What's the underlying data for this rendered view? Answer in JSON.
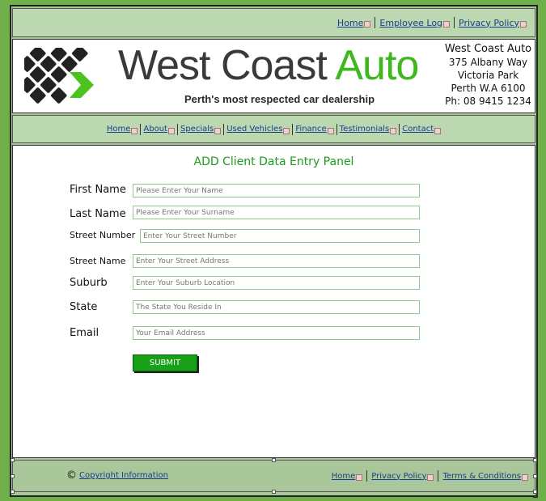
{
  "top_nav": {
    "items": [
      {
        "label": "Home"
      },
      {
        "label": "Employee Log"
      },
      {
        "label": "Privacy Policy"
      }
    ]
  },
  "header": {
    "brand_dark": "West Coast ",
    "brand_green": "Auto",
    "tagline": "Perth's most respected car dealership",
    "address": {
      "name": "West Coast Auto",
      "line1": "375 Albany Way",
      "line2": "Victoria Park",
      "line3": "Perth W.A 6100",
      "phone": "Ph: 08 9415 1234"
    }
  },
  "main_nav": {
    "items": [
      {
        "label": "Home"
      },
      {
        "label": "About"
      },
      {
        "label": "Specials"
      },
      {
        "label": "Used Vehicles"
      },
      {
        "label": "Finance"
      },
      {
        "label": "Testimonials"
      },
      {
        "label": "Contact"
      }
    ]
  },
  "form": {
    "title": "ADD Client Data Entry Panel",
    "fields": [
      {
        "label": "First Name",
        "placeholder": "Please Enter Your Name"
      },
      {
        "label": "Last Name",
        "placeholder": "Please Enter Your Surname"
      },
      {
        "label": "Street Number",
        "placeholder": "Enter Your Street Number"
      },
      {
        "label": "Street Name",
        "placeholder": "Enter Your Street Address"
      },
      {
        "label": "Suburb",
        "placeholder": "Enter Your Suburb Location"
      },
      {
        "label": "State",
        "placeholder": "The State You Reside In"
      },
      {
        "label": "Email",
        "placeholder": "Your Email Address"
      }
    ],
    "submit_label": "SUBMIT"
  },
  "footer": {
    "copyright_symbol": "©",
    "copyright_link": "Copyright Information",
    "links": [
      {
        "label": "Home"
      },
      {
        "label": "Privacy Policy"
      },
      {
        "label": "Terms & Conditions"
      }
    ]
  },
  "colors": {
    "background": "#6fb04a",
    "bar": "#bcd8b0",
    "brand_green": "#3db81e",
    "title_green": "#1e9a1e",
    "submit_green": "#18a018",
    "link_blue": "#1a3d8a"
  }
}
